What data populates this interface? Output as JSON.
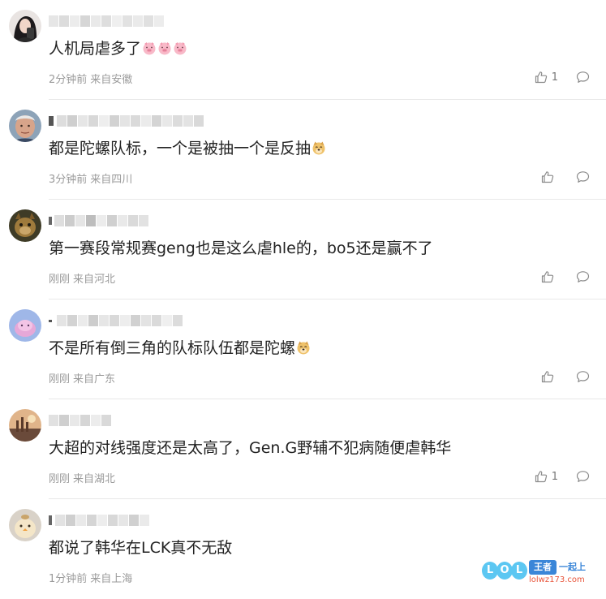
{
  "comments": [
    {
      "content": "人机局虐多了",
      "time": "2分钟前",
      "location": "来自安徽",
      "likes": "1",
      "emoji": "pig-face-icon",
      "emoji_count": 3
    },
    {
      "content": "都是陀螺队标，一个是被抽一个是反抽",
      "time": "3分钟前",
      "location": "来自四川",
      "likes": "",
      "emoji": "doge-face-icon",
      "emoji_count": 1
    },
    {
      "content": "第一赛段常规赛geng也是这么虐hle的，bo5还是赢不了",
      "time": "刚刚",
      "location": "来自河北",
      "likes": "",
      "emoji": "",
      "emoji_count": 0
    },
    {
      "content": "不是所有倒三角的队标队伍都是陀螺",
      "time": "刚刚",
      "location": "来自广东",
      "likes": "",
      "emoji": "doge-face-icon",
      "emoji_count": 1
    },
    {
      "content": "大超的对线强度还是太高了，Gen.G野辅不犯病随便虐韩华",
      "time": "刚刚",
      "location": "来自湖北",
      "likes": "1",
      "emoji": "",
      "emoji_count": 0
    },
    {
      "content": "都说了韩华在LCK真不无敌",
      "time": "1分钟前",
      "location": "来自上海",
      "likes": "",
      "emoji": "",
      "emoji_count": 0
    }
  ],
  "watermark": {
    "letters": [
      "L",
      "O",
      "L"
    ],
    "game": "王者",
    "slogan": "一起上",
    "site": "lolwz173.com"
  },
  "colors": {
    "text": "#222222",
    "meta": "#9a9a9a",
    "divider": "#e8e8e8",
    "icon": "#8a8a8a",
    "watermark_blue": "#5cc7f2",
    "watermark_red": "#e8553b"
  }
}
